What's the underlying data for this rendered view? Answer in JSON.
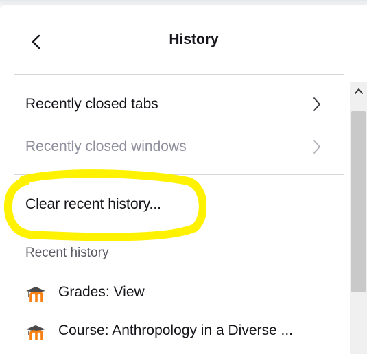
{
  "header": {
    "title": "History"
  },
  "menu": {
    "recently_closed_tabs": "Recently closed tabs",
    "recently_closed_windows": "Recently closed windows",
    "clear_recent_history": "Clear recent history..."
  },
  "recent_history": {
    "section_label": "Recent history",
    "items": [
      {
        "label": "Grades: View",
        "favicon": "moodle-icon"
      },
      {
        "label": "Course: Anthropology in a Diverse ...",
        "favicon": "moodle-icon"
      }
    ]
  },
  "colors": {
    "text": "#15141a",
    "disabled_text": "#8f8f9d",
    "highlight": "#fff200",
    "moodle_orange": "#f98012",
    "moodle_dark": "#4a4a4a"
  }
}
